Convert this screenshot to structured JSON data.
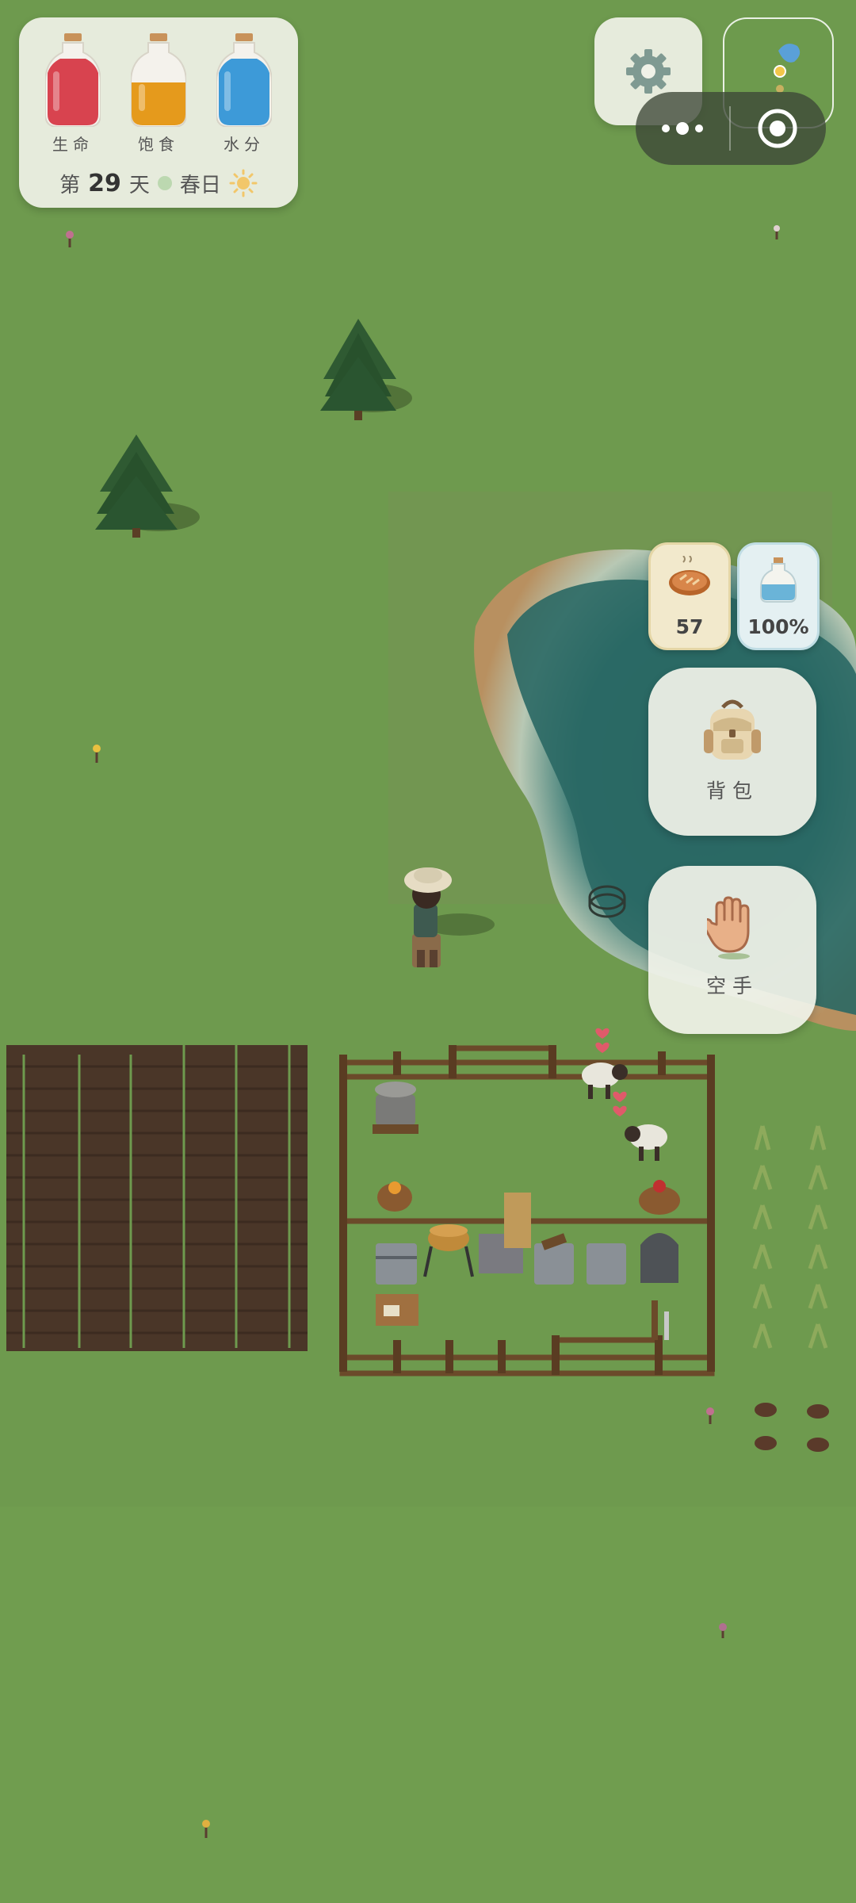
{
  "hud": {
    "stats": {
      "health": {
        "label": "生命",
        "color": "#d8434f",
        "level": 0.82
      },
      "satiety": {
        "label": "饱食",
        "color": "#e59a1c",
        "level": 0.62
      },
      "hydration": {
        "label": "水分",
        "color": "#3d9ad8",
        "level": 0.8
      }
    },
    "day": {
      "prefix": "第",
      "number": "29",
      "suffix": "天",
      "season": "春日",
      "weather_icon": "sun-icon"
    },
    "settings_icon": "gear-icon",
    "minimap_icon": "minimap",
    "capsule": {
      "more_icon": "more-dots-icon",
      "close_icon": "target-icon"
    }
  },
  "quick": {
    "food": {
      "icon": "bread-icon",
      "value": "57"
    },
    "water": {
      "icon": "water-bottle-icon",
      "value": "100%"
    }
  },
  "actions": {
    "backpack": {
      "icon": "backpack-icon",
      "label": "背包"
    },
    "hand": {
      "icon": "hand-icon",
      "label": "空手"
    }
  },
  "colors": {
    "grass": "#6e9a4e",
    "water": "#2f6f6a",
    "soil": "#4a3628",
    "fence": "#6b4a2a",
    "panel": "#f0f2e8"
  }
}
